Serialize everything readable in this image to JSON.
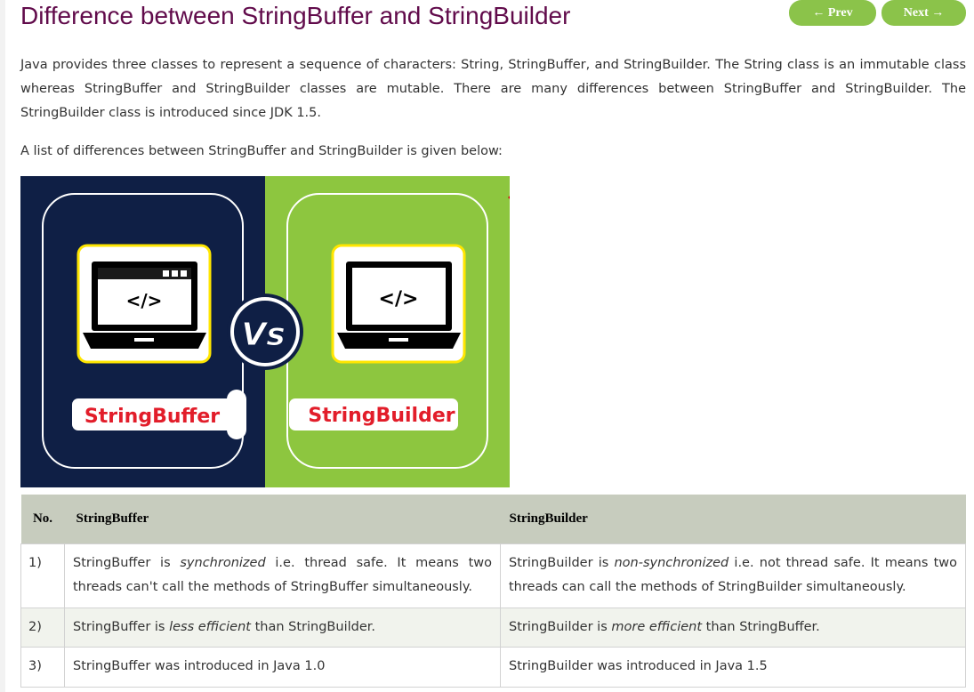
{
  "page": {
    "title": "Difference between StringBuffer and StringBuilder"
  },
  "nav": {
    "prev_label": "← Prev",
    "next_label": "Next →",
    "button_color": "#8bc34a"
  },
  "intro_paragraph": "Java provides three classes to represent a sequence of characters: String, StringBuffer, and StringBuilder. The String class is an immutable class whereas StringBuffer and StringBuilder classes are mutable. There are many differences between StringBuffer and StringBuilder. The StringBuilder class is introduced since JDK 1.5.",
  "list_intro": "A list of differences between StringBuffer and StringBuilder is given below:",
  "illustration": {
    "left_label": "StringBuffer",
    "right_label": "StringBuilder",
    "vs_text": "Vs",
    "code_glyph": "</>",
    "left_bg": "#0f1f45",
    "right_bg": "#8dc63f",
    "label_color": "#e21d2a"
  },
  "table": {
    "headers": [
      "No.",
      "StringBuffer",
      "StringBuilder"
    ],
    "header_bg": "#c7ccbe",
    "rows": [
      {
        "no": "1)",
        "buffer": {
          "pre": "StringBuffer is ",
          "em": "synchronized",
          "post": " i.e. thread safe. It means two threads can't call the methods of StringBuffer simultaneously."
        },
        "builder": {
          "pre": "StringBuilder is ",
          "em": "non-synchronized",
          "post": " i.e. not thread safe. It means two threads can call the methods of StringBuilder simultaneously."
        }
      },
      {
        "no": "2)",
        "buffer": {
          "pre": "StringBuffer is ",
          "em": "less efficient",
          "post": " than StringBuilder."
        },
        "builder": {
          "pre": "StringBuilder is ",
          "em": "more efficient",
          "post": " than StringBuffer."
        }
      },
      {
        "no": "3)",
        "buffer": {
          "pre": "StringBuffer was introduced in Java 1.0",
          "em": "",
          "post": ""
        },
        "builder": {
          "pre": "StringBuilder was introduced in Java 1.5",
          "em": "",
          "post": ""
        }
      }
    ]
  }
}
